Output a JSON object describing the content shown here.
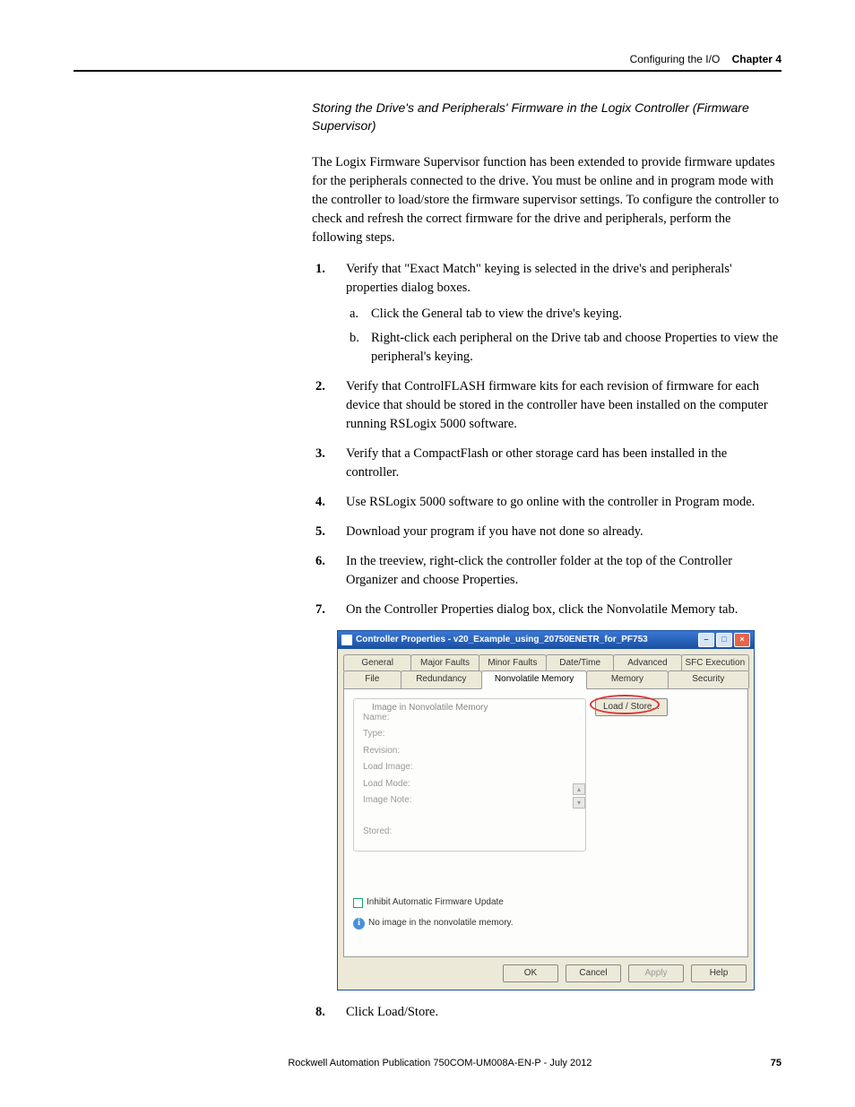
{
  "header": {
    "section": "Configuring the I/O",
    "chapter_label": "Chapter 4"
  },
  "subheading": "Storing the Drive's and Peripherals' Firmware in the Logix Controller (Firmware Supervisor)",
  "intro": "The Logix Firmware Supervisor function has been extended to provide firmware updates for the peripherals connected to the drive. You must be online and in program mode with the controller to load/store the firmware supervisor settings. To configure the controller to check and refresh the correct firmware for the drive and peripherals, perform the following steps.",
  "steps": [
    {
      "num": "1.",
      "text": "Verify that \"Exact Match\" keying is selected in the drive's and peripherals' properties dialog boxes.",
      "subs": [
        {
          "lett": "a.",
          "text": "Click the General tab to view the drive's keying."
        },
        {
          "lett": "b.",
          "text": "Right-click each peripheral on the Drive tab and choose Properties to view the peripheral's keying."
        }
      ]
    },
    {
      "num": "2.",
      "text": "Verify that ControlFLASH firmware kits for each revision of firmware for each device that should be stored in the controller have been installed on the computer running RSLogix 5000 software."
    },
    {
      "num": "3.",
      "text": "Verify that a CompactFlash or other storage card has been installed in the controller."
    },
    {
      "num": "4.",
      "text": "Use RSLogix 5000 software to go online with the controller in Program mode."
    },
    {
      "num": "5.",
      "text": "Download your program if you have not done so already."
    },
    {
      "num": "6.",
      "text": "In the treeview, right-click the controller folder at the top of the Controller Organizer and choose Properties."
    },
    {
      "num": "7.",
      "text": "On the Controller Properties dialog box, click the Nonvolatile Memory tab."
    }
  ],
  "step8": {
    "num": "8.",
    "text": "Click Load/Store."
  },
  "dialog": {
    "title": "Controller Properties - v20_Example_using_20750ENETR_for_PF753",
    "tabs_upper": [
      "General",
      "Major Faults",
      "Minor Faults",
      "Date/Time",
      "Advanced",
      "SFC Execution"
    ],
    "tabs_lower": [
      "File",
      "Redundancy",
      "Nonvolatile Memory",
      "Memory",
      "Security"
    ],
    "active_tab": "Nonvolatile Memory",
    "group_label": "Image in Nonvolatile Memory",
    "fields": [
      "Name:",
      "Type:",
      "Revision:",
      "Load Image:",
      "Load Mode:",
      "Image Note:",
      "Stored:"
    ],
    "loadstore": "Load / Store...",
    "checkbox": "Inhibit Automatic Firmware Update",
    "info": "No image in the nonvolatile memory.",
    "buttons": {
      "ok": "OK",
      "cancel": "Cancel",
      "apply": "Apply",
      "help": "Help"
    }
  },
  "footer": {
    "publication": "Rockwell Automation Publication 750COM-UM008A-EN-P - July 2012",
    "page": "75"
  }
}
